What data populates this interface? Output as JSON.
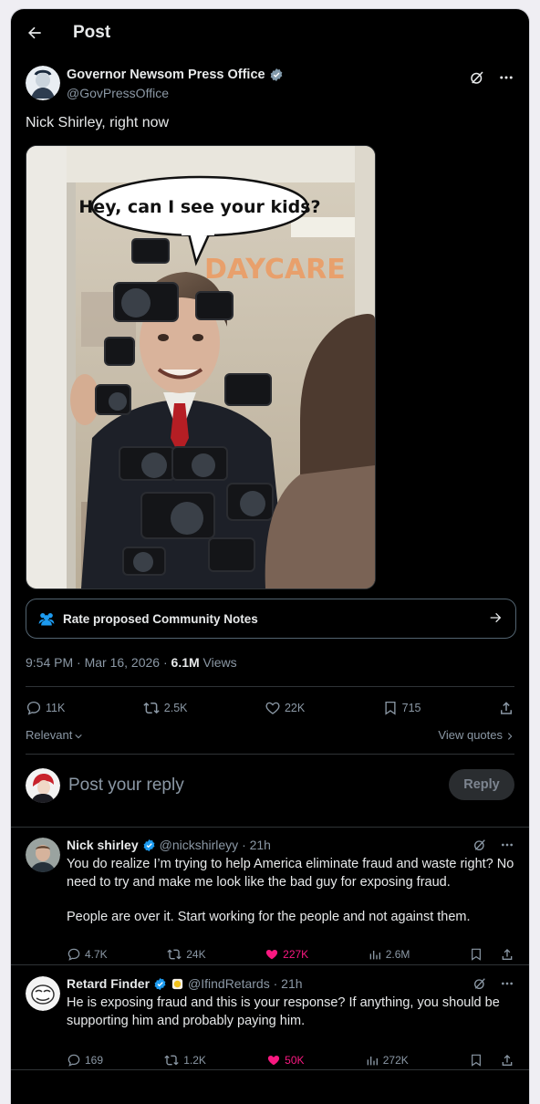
{
  "header": {
    "title": "Post"
  },
  "post": {
    "author_name": "Governor Newsom Press Office",
    "author_handle": "@GovPressOffice",
    "text": "Nick Shirley, right now",
    "image_caption": "Hey, can I see your kids?",
    "image_sign": "DAYCARE",
    "community_notes_label": "Rate proposed Community Notes",
    "timestamp": "9:54 PM · Mar 16, 2026 · ",
    "views_count": "6.1M",
    "views_label": " Views",
    "replies": "11K",
    "reposts": "2.5K",
    "likes": "22K",
    "bookmarks": "715"
  },
  "sort": {
    "relevant": "Relevant",
    "view_quotes": "View quotes"
  },
  "compose": {
    "placeholder": "Post your reply",
    "button": "Reply"
  },
  "replies": [
    {
      "name": "Nick shirley",
      "handle": "@nickshirleyy · 21h",
      "body_p1": "You do realize I’m trying to help America eliminate fraud and waste right? No need to try and make me look like the bad guy for exposing fraud.",
      "body_p2": "People are over it. Start working for the people and not against them.",
      "replies": "4.7K",
      "reposts": "24K",
      "likes": "227K",
      "views": "2.6M"
    },
    {
      "name": "Retard Finder",
      "handle": "@IfindRetards · 21h",
      "body_p1": "He is exposing fraud and this is your response? If anything, you should be supporting him and probably paying him.",
      "replies": "169",
      "reposts": "1.2K",
      "likes": "50K",
      "views": "272K"
    }
  ],
  "colors": {
    "background": "#000000",
    "text": "#e7e9ea",
    "muted": "#8b98a5",
    "verified": "#1d9bf0",
    "like": "#f91880",
    "border": "#2f3336"
  }
}
